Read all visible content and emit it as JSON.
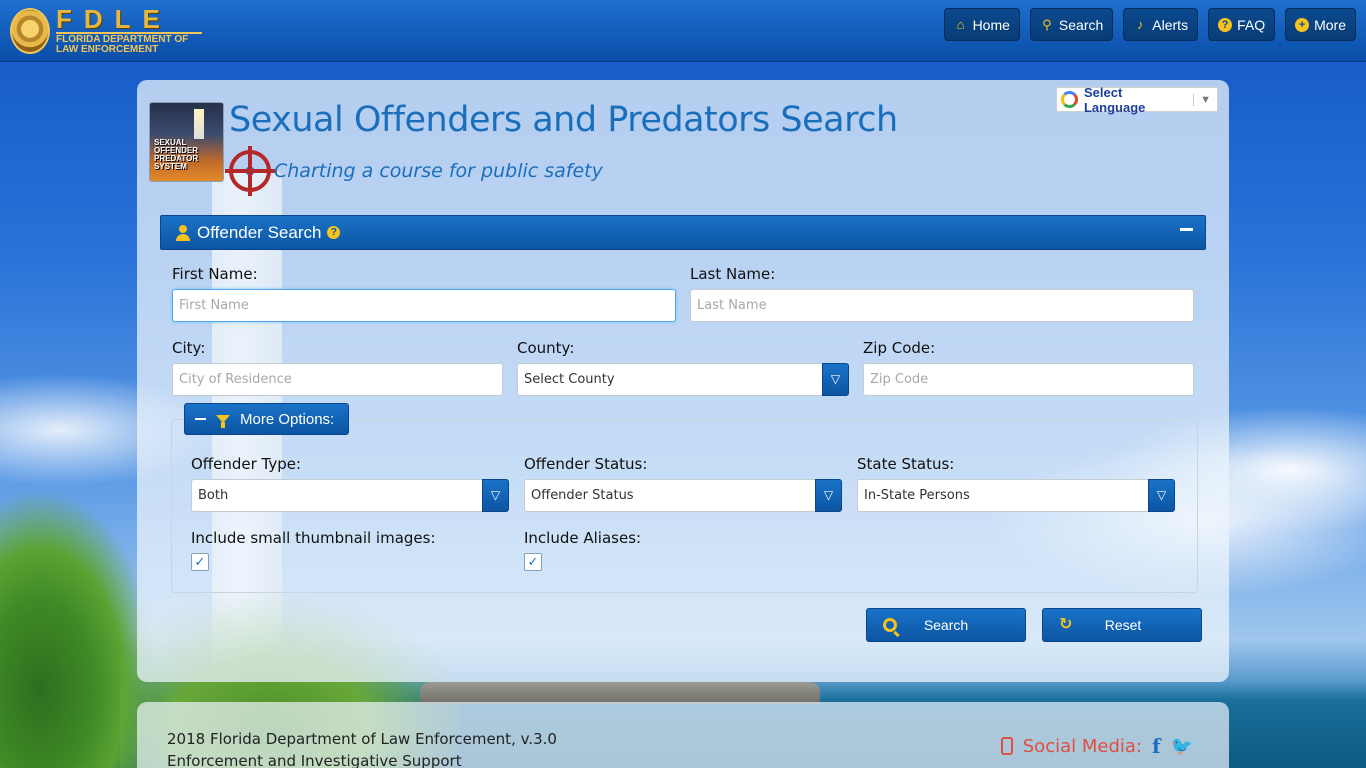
{
  "header": {
    "logo_title": "FDLE",
    "logo_sub_line1": "FLORIDA DEPARTMENT OF",
    "logo_sub_line2": "LAW ENFORCEMENT",
    "nav": [
      {
        "label": "Home",
        "icon": "home-icon"
      },
      {
        "label": "Search",
        "icon": "search-icon"
      },
      {
        "label": "Alerts",
        "icon": "bell-icon"
      },
      {
        "label": "FAQ",
        "icon": "question-icon"
      },
      {
        "label": "More",
        "icon": "plus-circle-icon"
      }
    ]
  },
  "page": {
    "logo_text": [
      "SEXUAL",
      "OFFENDER",
      "PREDATOR",
      "SYSTEM"
    ],
    "title": "Sexual Offenders and Predators Search",
    "tagline": "Charting a course for public safety",
    "language_label": "Select Language"
  },
  "search": {
    "section_title": "Offender Search",
    "first_name": {
      "label": "First Name:",
      "placeholder": "First Name",
      "value": ""
    },
    "last_name": {
      "label": "Last Name:",
      "placeholder": "Last Name",
      "value": ""
    },
    "city": {
      "label": "City:",
      "placeholder": "City of Residence",
      "value": ""
    },
    "county": {
      "label": "County:",
      "selected": "Select County"
    },
    "zip": {
      "label": "Zip Code:",
      "placeholder": "Zip Code",
      "value": ""
    },
    "more_options_label": "More Options:",
    "offender_type": {
      "label": "Offender Type:",
      "selected": "Both"
    },
    "offender_status": {
      "label": "Offender Status:",
      "selected": "Offender Status"
    },
    "state_status": {
      "label": "State Status:",
      "selected": "In-State Persons"
    },
    "thumbnails": {
      "label": "Include small thumbnail images:",
      "checked": true
    },
    "aliases": {
      "label": "Include Aliases:",
      "checked": true
    },
    "search_button": "Search",
    "reset_button": "Reset"
  },
  "footer": {
    "line1": "2018 Florida Department of Law Enforcement, v.3.0",
    "line2": "Enforcement and Investigative Support",
    "social_label": "Social Media:"
  },
  "colors": {
    "accent": "#1a6fbd",
    "button_blue": "#0c55a3",
    "icon_gold": "#f6c21c",
    "social_red": "#e05040"
  }
}
